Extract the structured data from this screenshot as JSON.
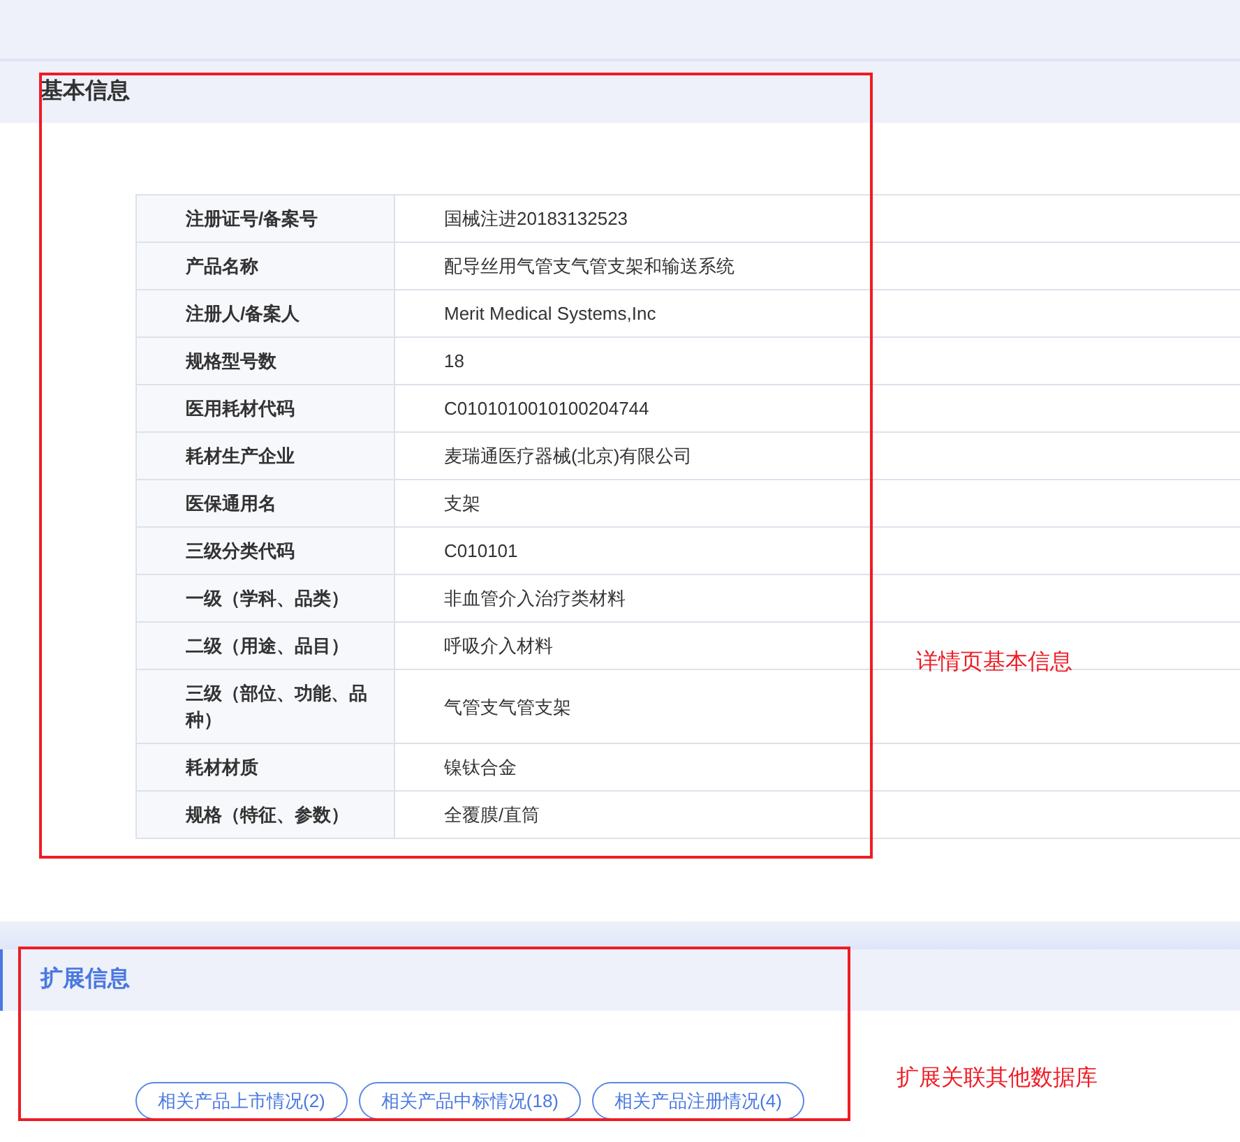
{
  "basic_section": {
    "title": "基本信息",
    "rows": [
      {
        "label": "注册证号/备案号",
        "value": "国械注进20183132523"
      },
      {
        "label": "产品名称",
        "value": "配导丝用气管支气管支架和输送系统"
      },
      {
        "label": "注册人/备案人",
        "value": "Merit Medical Systems,Inc"
      },
      {
        "label": "规格型号数",
        "value": "18"
      },
      {
        "label": "医用耗材代码",
        "value": "C0101010010100204744"
      },
      {
        "label": "耗材生产企业",
        "value": "麦瑞通医疗器械(北京)有限公司"
      },
      {
        "label": "医保通用名",
        "value": "支架"
      },
      {
        "label": "三级分类代码",
        "value": "C010101"
      },
      {
        "label": "一级（学科、品类）",
        "value": "非血管介入治疗类材料"
      },
      {
        "label": "二级（用途、品目）",
        "value": "呼吸介入材料"
      },
      {
        "label": "三级（部位、功能、品种）",
        "value": "气管支气管支架"
      },
      {
        "label": "耗材材质",
        "value": "镍钛合金"
      },
      {
        "label": "规格（特征、参数）",
        "value": "全覆膜/直筒"
      }
    ]
  },
  "extended_section": {
    "title": "扩展信息",
    "buttons": [
      "相关产品上市情况(2)",
      "相关产品中标情况(18)",
      "相关产品注册情况(4)"
    ]
  },
  "annotations": [
    {
      "text": "详情页基本信息"
    },
    {
      "text": "扩展关联其他数据库"
    }
  ]
}
